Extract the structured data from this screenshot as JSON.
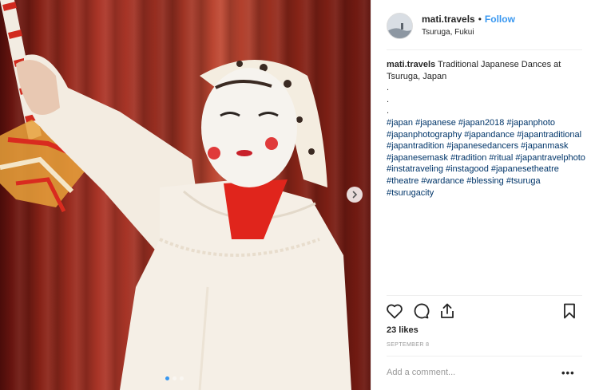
{
  "post": {
    "username": "mati.travels",
    "separator": "•",
    "follow_label": "Follow",
    "location": "Tsuruga, Fukui",
    "caption_text": "Traditional Japanese Dances at Tsuruga, Japan",
    "caption_dots": [
      ".",
      ".",
      "."
    ],
    "hashtags": "#japan #japanese #japan2018 #japanphoto #japanphotography #japandance #japantraditional #japantradition #japanesedancers #japanmask #japanesemask #tradition #ritual #japantravelphoto #instatraveling #instagood #japanesetheatre #theatre #wardance #blessing #tsuruga #tsurugacity",
    "likes": "23 likes",
    "date": "SEPTEMBER 8",
    "comment_placeholder": "Add a comment...",
    "more_label": "•••"
  },
  "carousel": {
    "slide_count": 3,
    "active_slide": 1
  },
  "icons": {
    "like": "heart-icon",
    "comment": "comment-bubble-icon",
    "share": "share-icon",
    "save": "bookmark-icon",
    "next": "chevron-right-icon"
  },
  "colors": {
    "accent": "#3897f0",
    "hashtag": "#003569",
    "muted": "#999999",
    "text": "#262626"
  }
}
